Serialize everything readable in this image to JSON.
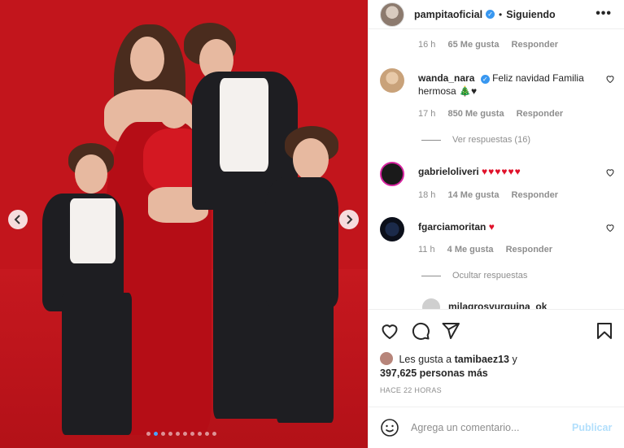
{
  "header": {
    "username": "pampitaoficial",
    "separator": "•",
    "follow_status": "Siguiendo",
    "more": "•••"
  },
  "comments": [
    {
      "id": "top",
      "time": "16 h",
      "likes": "65 Me gusta",
      "reply": "Responder"
    },
    {
      "id": "wanda",
      "username": "wanda_nara",
      "verified": true,
      "text": "Feliz navidad Familia hermosa 🎄♥",
      "time": "17 h",
      "likes": "850 Me gusta",
      "reply": "Responder",
      "replies_toggle": "Ver respuestas (16)"
    },
    {
      "id": "gabriel",
      "username": "gabrieloliveri",
      "text": "♥♥♥♥♥♥",
      "time": "18 h",
      "likes": "14 Me gusta",
      "reply": "Responder"
    },
    {
      "id": "fgarcia",
      "username": "fgarciamoritan",
      "text": "♥",
      "time": "11 h",
      "likes": "4 Me gusta",
      "reply": "Responder",
      "replies_toggle": "Ocultar respuestas"
    },
    {
      "id": "partial",
      "username": "milagrosyurquina_ok"
    }
  ],
  "likes_summary": {
    "prefix": "Les gusta a",
    "user": "tamibaez13",
    "connector": "y",
    "count": "397,625 personas más"
  },
  "timestamp": "HACE 22 HORAS",
  "add_comment": {
    "placeholder": "Agrega un comentario...",
    "post_label": "Publicar"
  },
  "carousel": {
    "dot_count": 10,
    "active_index": 1
  },
  "colors": {
    "photo_background": "#c2151c",
    "verified": "#3897f0",
    "heart": "#e0112a",
    "post_button": "#b2dffc"
  },
  "icons": [
    "chevron-left-icon",
    "chevron-right-icon",
    "heart-icon",
    "comment-icon",
    "share-icon",
    "bookmark-icon",
    "emoji-icon",
    "verified-icon",
    "more-icon"
  ]
}
